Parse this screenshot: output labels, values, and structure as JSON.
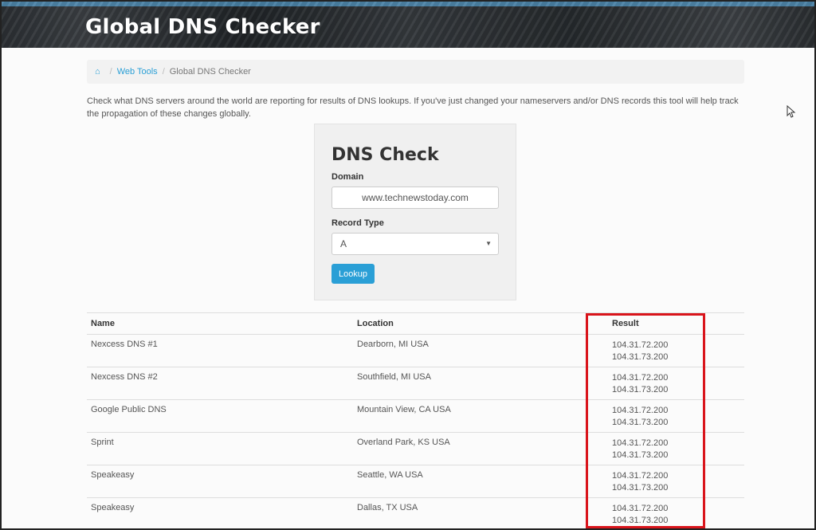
{
  "header": {
    "title": "Global DNS Checker"
  },
  "breadcrumb": {
    "home_icon": "home-icon",
    "items": [
      "Web Tools",
      "Global DNS Checker"
    ]
  },
  "intro_text": "Check what DNS servers around the world are reporting for results of DNS lookups. If you've just changed your nameservers and/or DNS records this tool will help track the propagation of these changes globally.",
  "form": {
    "title": "DNS Check",
    "domain_label": "Domain",
    "domain_value": "www.technewstoday.com",
    "record_label": "Record Type",
    "record_value": "A",
    "lookup_label": "Lookup"
  },
  "table": {
    "headers": [
      "Name",
      "Location",
      "Result"
    ],
    "rows": [
      {
        "name": "Nexcess DNS #1",
        "location": "Dearborn, MI USA",
        "results": [
          "104.31.72.200",
          "104.31.73.200"
        ]
      },
      {
        "name": "Nexcess DNS #2",
        "location": "Southfield, MI USA",
        "results": [
          "104.31.72.200",
          "104.31.73.200"
        ]
      },
      {
        "name": "Google Public DNS",
        "location": "Mountain View, CA USA",
        "results": [
          "104.31.72.200",
          "104.31.73.200"
        ]
      },
      {
        "name": "Sprint",
        "location": "Overland Park, KS USA",
        "results": [
          "104.31.72.200",
          "104.31.73.200"
        ]
      },
      {
        "name": "Speakeasy",
        "location": "Seattle, WA USA",
        "results": [
          "104.31.72.200",
          "104.31.73.200"
        ]
      },
      {
        "name": "Speakeasy",
        "location": "Dallas, TX USA",
        "results": [
          "104.31.72.200",
          "104.31.73.200"
        ]
      }
    ]
  },
  "colors": {
    "accent": "#2a9fd6",
    "highlight": "#d9141b"
  }
}
